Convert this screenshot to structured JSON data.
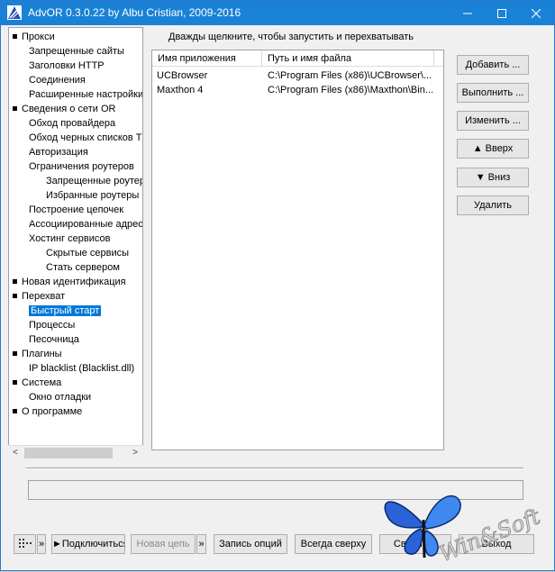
{
  "window": {
    "title": "AdvOR  0.3.0.22 by Albu Cristian, 2009-2016"
  },
  "tree": {
    "items": [
      {
        "label": "Прокси",
        "level": 0
      },
      {
        "label": "Запрещенные сайты",
        "level": 1
      },
      {
        "label": "Заголовки HTTP",
        "level": 1
      },
      {
        "label": "Соединения",
        "level": 1
      },
      {
        "label": "Расширенные настройки",
        "level": 1
      },
      {
        "label": "Сведения о сети OR",
        "level": 0
      },
      {
        "label": "Обход провайдера",
        "level": 1
      },
      {
        "label": "Обход черных списков T",
        "level": 1
      },
      {
        "label": "Авторизация",
        "level": 1
      },
      {
        "label": "Ограничения роутеров",
        "level": 1
      },
      {
        "label": "Запрещенные роутер",
        "level": 2
      },
      {
        "label": "Избранные роутеры",
        "level": 2
      },
      {
        "label": "Построение цепочек",
        "level": 1
      },
      {
        "label": "Ассоциированные адрес",
        "level": 1
      },
      {
        "label": "Хостинг сервисов",
        "level": 1
      },
      {
        "label": "Скрытые сервисы",
        "level": 2
      },
      {
        "label": "Стать сервером",
        "level": 2
      },
      {
        "label": "Новая идентификация",
        "level": 0
      },
      {
        "label": "Перехват",
        "level": 0
      },
      {
        "label": "Быстрый старт",
        "level": 1,
        "selected": true
      },
      {
        "label": "Процессы",
        "level": 1
      },
      {
        "label": "Песочница",
        "level": 1
      },
      {
        "label": "Плагины",
        "level": 0
      },
      {
        "label": "IP blacklist (Blacklist.dll)",
        "level": 1
      },
      {
        "label": "Система",
        "level": 0
      },
      {
        "label": "Окно отладки",
        "level": 1
      },
      {
        "label": "О программе",
        "level": 0
      }
    ]
  },
  "main": {
    "hint": "Дважды щелкните, чтобы запустить и перехватывать",
    "columns": [
      "Имя приложения",
      "Путь и имя файла"
    ],
    "rows": [
      [
        "UCBrowser",
        "C:\\Program Files (x86)\\UCBrowser\\..."
      ],
      [
        "Maxthon 4",
        "C:\\Program Files (x86)\\Maxthon\\Bin..."
      ]
    ],
    "buttons": {
      "add": "Добавить ...",
      "run": "Выполнить ...",
      "edit": "Изменить ...",
      "up": "▲ Вверх",
      "down": "▼ Вниз",
      "delete": "Удалить"
    }
  },
  "toolbar": {
    "menu_glyph": "»",
    "connect": "►Подключиться",
    "new_chain": "Новая цепь",
    "more_glyph": "»",
    "save_options": "Запись опций",
    "always_on_top": "Всегда сверху",
    "minimize": "Свернуть",
    "exit": "Выход"
  },
  "watermark": {
    "text": "Win&Soft"
  },
  "colors": {
    "titlebar": "#1a82d6",
    "selection": "#0078d7"
  }
}
